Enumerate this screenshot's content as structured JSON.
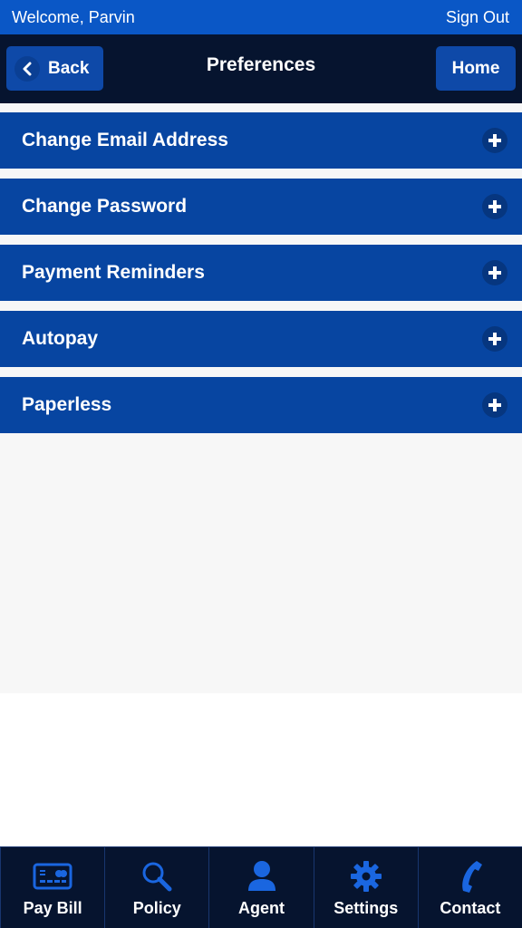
{
  "status_bar": {
    "welcome_text": "Welcome, Parvin",
    "sign_out_label": "Sign Out"
  },
  "nav": {
    "back_label": "Back",
    "title": "Preferences",
    "home_label": "Home"
  },
  "preferences": [
    {
      "label": "Change Email Address",
      "icon": "plus-icon"
    },
    {
      "label": "Change Password",
      "icon": "plus-icon"
    },
    {
      "label": "Payment Reminders",
      "icon": "plus-icon"
    },
    {
      "label": "Autopay",
      "icon": "plus-icon"
    },
    {
      "label": "Paperless",
      "icon": "plus-icon"
    }
  ],
  "tabs": [
    {
      "label": "Pay Bill",
      "icon": "credit-card-icon"
    },
    {
      "label": "Policy",
      "icon": "search-icon"
    },
    {
      "label": "Agent",
      "icon": "person-icon"
    },
    {
      "label": "Settings",
      "icon": "gear-icon"
    },
    {
      "label": "Contact",
      "icon": "phone-icon"
    }
  ],
  "colors": {
    "top_bar": "#0a57c6",
    "nav_bar": "#06142f",
    "button": "#0e49a8",
    "list_item": "#0745a1",
    "tab_icon": "#1a66e0",
    "content_bg": "#f7f7f7"
  }
}
